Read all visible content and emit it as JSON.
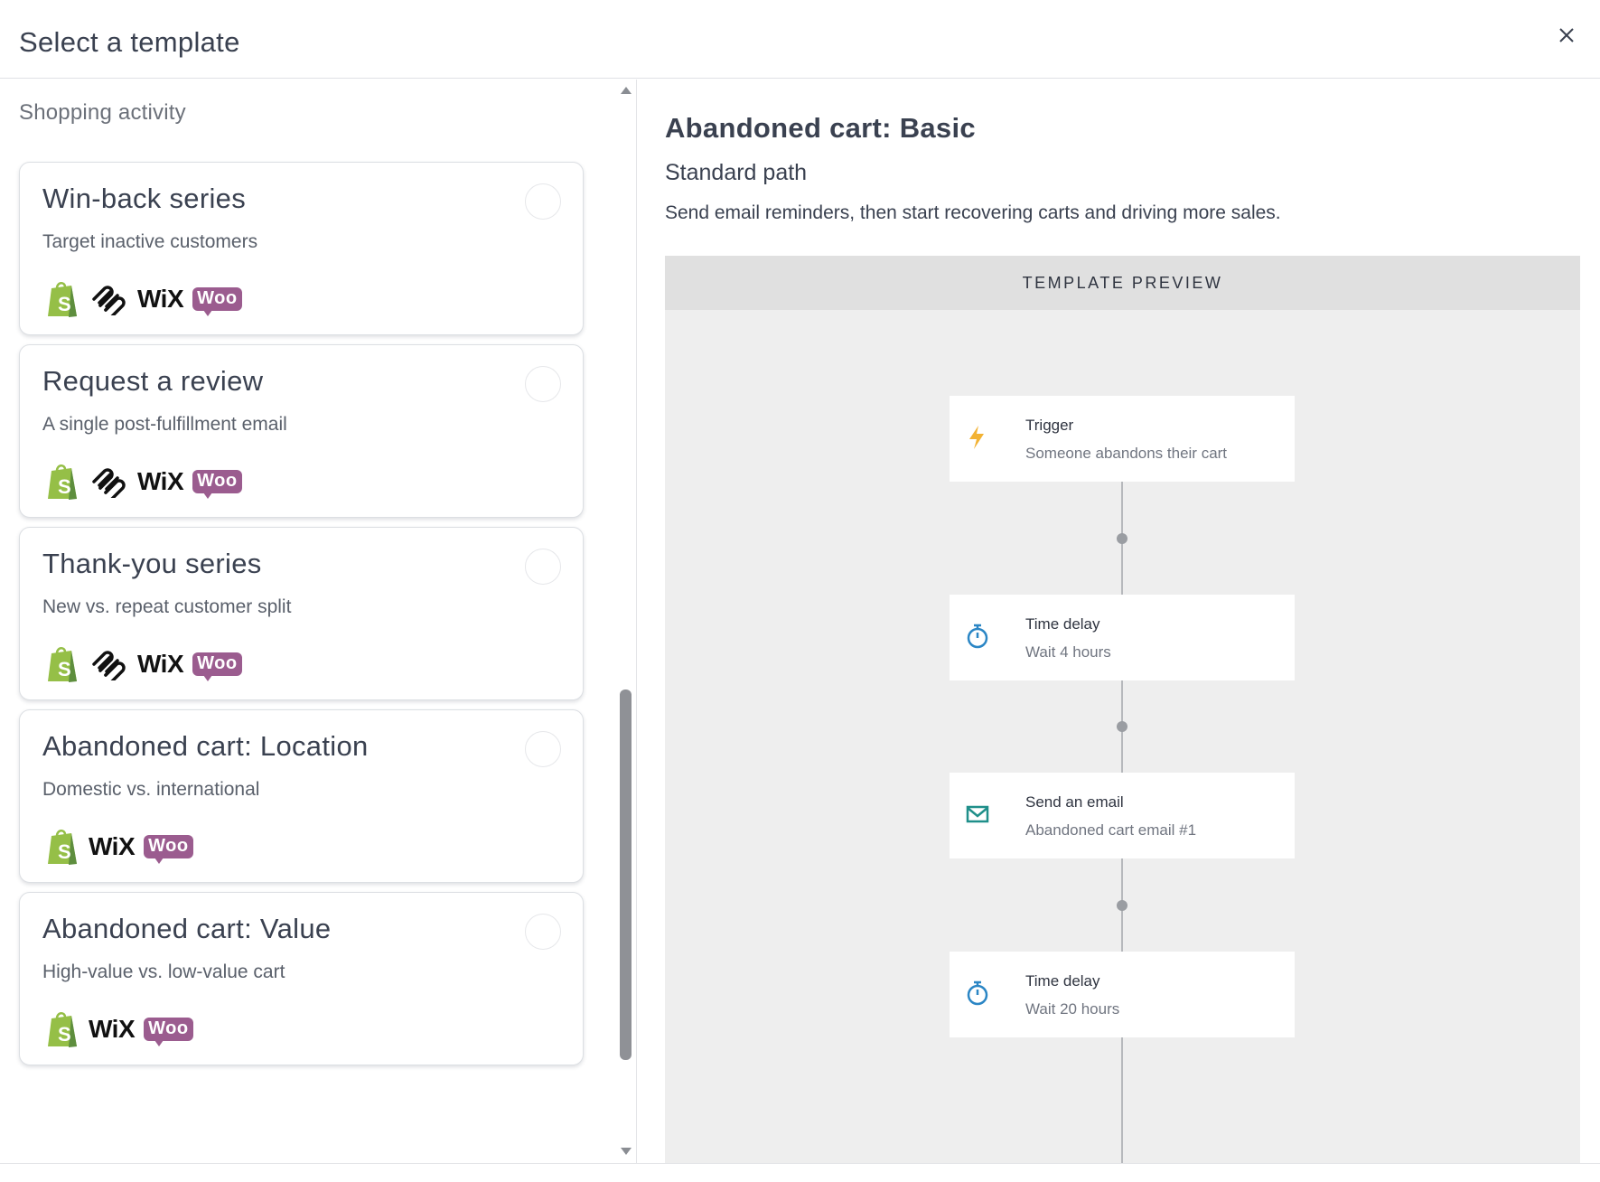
{
  "header": {
    "title": "Select a template"
  },
  "left": {
    "section_label": "Shopping activity",
    "cards": [
      {
        "title": "Win-back series",
        "description": "Target inactive customers",
        "logos": [
          "shopify",
          "squarespace",
          "wix",
          "woo"
        ]
      },
      {
        "title": "Request a review",
        "description": "A single post-fulfillment email",
        "logos": [
          "shopify",
          "squarespace",
          "wix",
          "woo"
        ]
      },
      {
        "title": "Thank-you series",
        "description": "New vs. repeat customer split",
        "logos": [
          "shopify",
          "squarespace",
          "wix",
          "woo"
        ]
      },
      {
        "title": "Abandoned cart: Location",
        "description": "Domestic vs. international",
        "logos": [
          "shopify",
          "wix",
          "woo"
        ]
      },
      {
        "title": "Abandoned cart: Value",
        "description": "High-value vs. low-value cart",
        "logos": [
          "shopify",
          "wix",
          "woo"
        ]
      }
    ],
    "logo_text": {
      "wix": "WiX",
      "woo": "Woo"
    }
  },
  "detail": {
    "title": "Abandoned cart: Basic",
    "subtitle": "Standard path",
    "description": "Send email reminders, then start recovering carts and driving more sales.",
    "preview_label": "TEMPLATE PREVIEW",
    "steps": [
      {
        "title": "Trigger",
        "subtitle": "Someone abandons their cart",
        "icon": "lightning-icon"
      },
      {
        "title": "Time delay",
        "subtitle": "Wait 4 hours",
        "icon": "stopwatch-icon"
      },
      {
        "title": "Send an email",
        "subtitle": "Abandoned cart email #1",
        "icon": "envelope-icon"
      },
      {
        "title": "Time delay",
        "subtitle": "Wait 20 hours",
        "icon": "stopwatch-icon"
      }
    ]
  },
  "colors": {
    "text": "#3a4150",
    "trigger_icon": "#f2b233",
    "delay_icon": "#2b86c5",
    "email_icon": "#1f8f8a",
    "woo_brand": "#9b5c8f",
    "shopify_brand": "#95bf47",
    "preview_bg": "#eeeeee"
  }
}
